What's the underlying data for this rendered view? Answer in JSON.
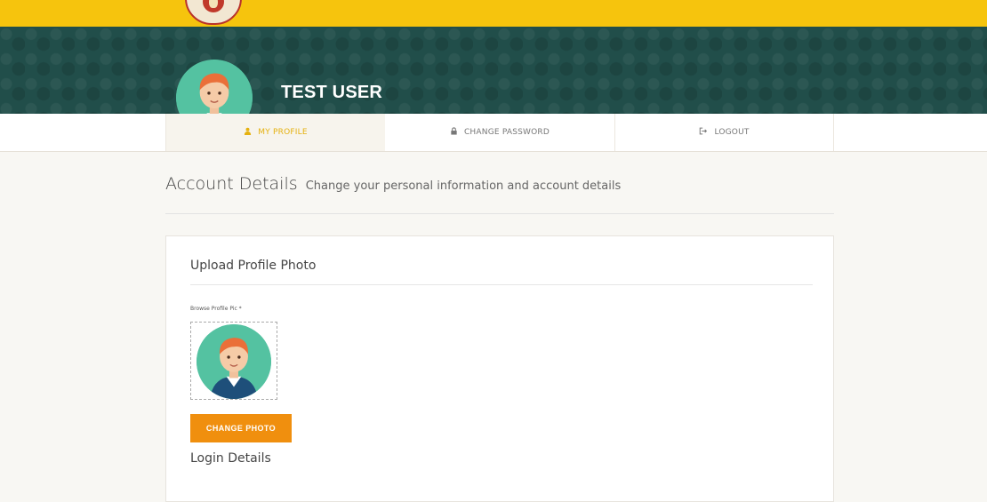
{
  "header": {
    "user_name": "TEST USER",
    "colors": {
      "topbar": "#f6c40d",
      "banner": "#214e4a",
      "accent": "#f08f0e"
    }
  },
  "tabs": [
    {
      "label": "MY PROFILE",
      "icon": "user-icon",
      "active": true
    },
    {
      "label": "CHANGE PASSWORD",
      "icon": "lock-icon",
      "active": false
    },
    {
      "label": "LOGOUT",
      "icon": "logout-icon",
      "active": false
    }
  ],
  "page": {
    "title": "Account Details",
    "subtitle": "Change your personal information and account details"
  },
  "upload": {
    "title": "Upload Profile Photo",
    "field_label": "Browse Profile Pic *",
    "button_label": "CHANGE PHOTO"
  },
  "next_section": {
    "title": "Login Details"
  }
}
